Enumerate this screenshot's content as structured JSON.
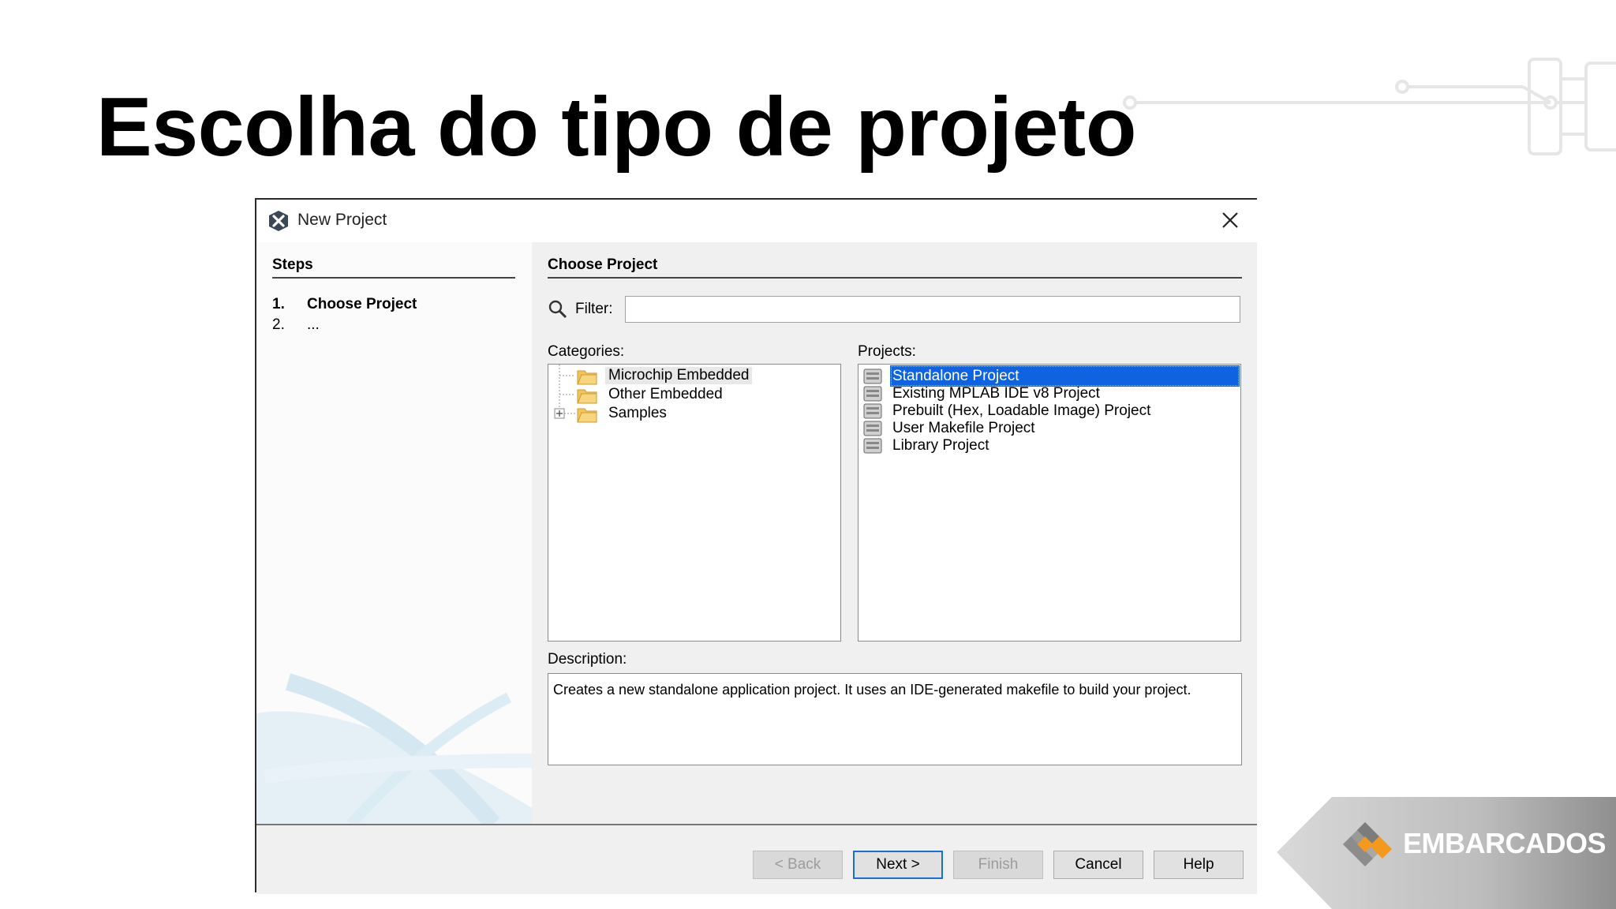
{
  "slide": {
    "title": "Escolha do tipo de projeto"
  },
  "dialog": {
    "title": "New Project",
    "steps": {
      "heading": "Steps",
      "items": [
        {
          "num": "1.",
          "label": "Choose Project"
        },
        {
          "num": "2.",
          "label": "..."
        }
      ]
    },
    "main": {
      "heading": "Choose Project",
      "filter_label": "Filter:",
      "filter_value": "",
      "categories_label": "Categories:",
      "categories": [
        {
          "label": "Microchip Embedded",
          "selected": true
        },
        {
          "label": "Other Embedded",
          "selected": false
        },
        {
          "label": "Samples",
          "selected": false,
          "expandable": true
        }
      ],
      "projects_label": "Projects:",
      "projects": [
        {
          "label": "Standalone Project",
          "selected": true
        },
        {
          "label": "Existing MPLAB IDE v8 Project",
          "selected": false
        },
        {
          "label": "Prebuilt (Hex, Loadable Image) Project",
          "selected": false
        },
        {
          "label": "User Makefile Project",
          "selected": false
        },
        {
          "label": "Library Project",
          "selected": false
        }
      ],
      "description_label": "Description:",
      "description": "Creates a new standalone application project. It uses an IDE-generated makefile to build your project."
    },
    "buttons": {
      "back": "< Back",
      "next": "Next >",
      "finish": "Finish",
      "cancel": "Cancel",
      "help": "Help"
    }
  },
  "logo": {
    "text": "EMBARCADOS"
  },
  "colors": {
    "selection": "#0f62e0",
    "panel": "#f0f0f0",
    "logo_orange": "#f39a1e"
  }
}
